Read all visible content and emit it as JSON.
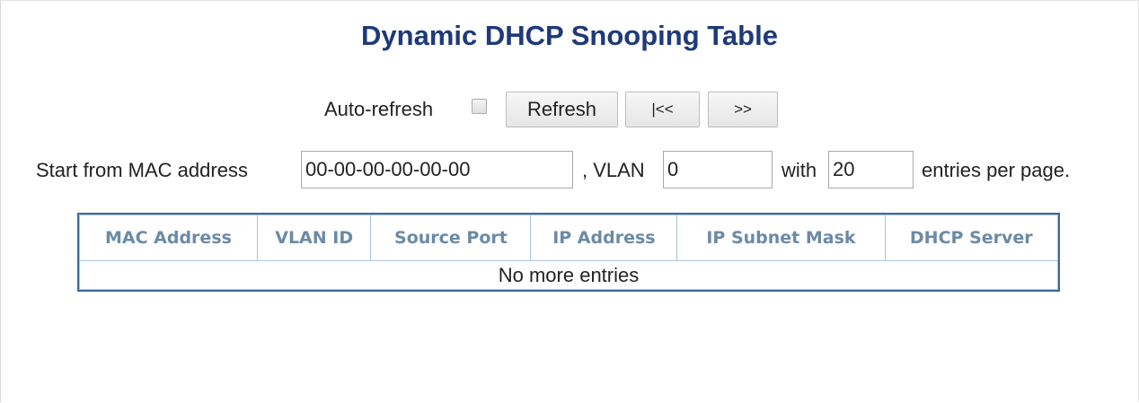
{
  "title": "Dynamic DHCP Snooping Table",
  "controls": {
    "auto_refresh_label": "Auto-refresh",
    "auto_refresh_checked": false,
    "refresh_label": "Refresh",
    "first_page_label": "|<<",
    "next_page_label": ">>"
  },
  "filter": {
    "start_label": "Start from MAC address",
    "mac_value": "00-00-00-00-00-00",
    "vlan_label": ", VLAN",
    "vlan_value": "0",
    "with_label": "with",
    "entries_value": "20",
    "entries_suffix": "entries per page."
  },
  "table": {
    "headers": [
      "MAC Address",
      "VLAN ID",
      "Source Port",
      "IP Address",
      "IP Subnet Mask",
      "DHCP Server"
    ],
    "empty_message": "No more entries"
  }
}
